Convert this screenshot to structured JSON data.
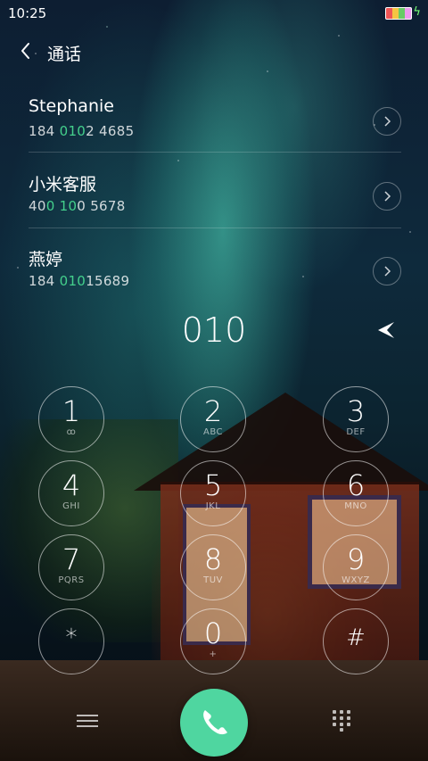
{
  "status_bar": {
    "time": "10:25"
  },
  "header": {
    "back_icon": "chevron-left-icon",
    "title": "通话"
  },
  "suggestions": [
    {
      "name": "Stephanie",
      "number_parts": [
        "184 ",
        "010",
        "2  4685"
      ]
    },
    {
      "name": "小米客服",
      "number_parts": [
        "40",
        "0 10",
        "0  5678"
      ]
    },
    {
      "name": "燕婷",
      "number_parts": [
        "184  ",
        "010",
        "15689"
      ]
    }
  ],
  "detail_icon": "chevron-right-icon",
  "dialer": {
    "typed_number": "010",
    "delete_icon": "backspace-icon",
    "keys": [
      {
        "digit": "1",
        "letters": "ꝏ"
      },
      {
        "digit": "2",
        "letters": "ABC"
      },
      {
        "digit": "3",
        "letters": "DEF"
      },
      {
        "digit": "4",
        "letters": "GHI"
      },
      {
        "digit": "5",
        "letters": "JKL"
      },
      {
        "digit": "6",
        "letters": "MNO"
      },
      {
        "digit": "7",
        "letters": "PQRS"
      },
      {
        "digit": "8",
        "letters": "TUV"
      },
      {
        "digit": "9",
        "letters": "WXYZ"
      },
      {
        "digit": "*",
        "letters": ""
      },
      {
        "digit": "0",
        "letters": "+"
      },
      {
        "digit": "#",
        "letters": ""
      }
    ]
  },
  "bottom_bar": {
    "menu_icon": "menu-icon",
    "call_icon": "phone-icon",
    "keypad_icon": "dialpad-icon"
  },
  "colors": {
    "accent_green": "#44d08c",
    "call_button": "#4fd6a0"
  }
}
